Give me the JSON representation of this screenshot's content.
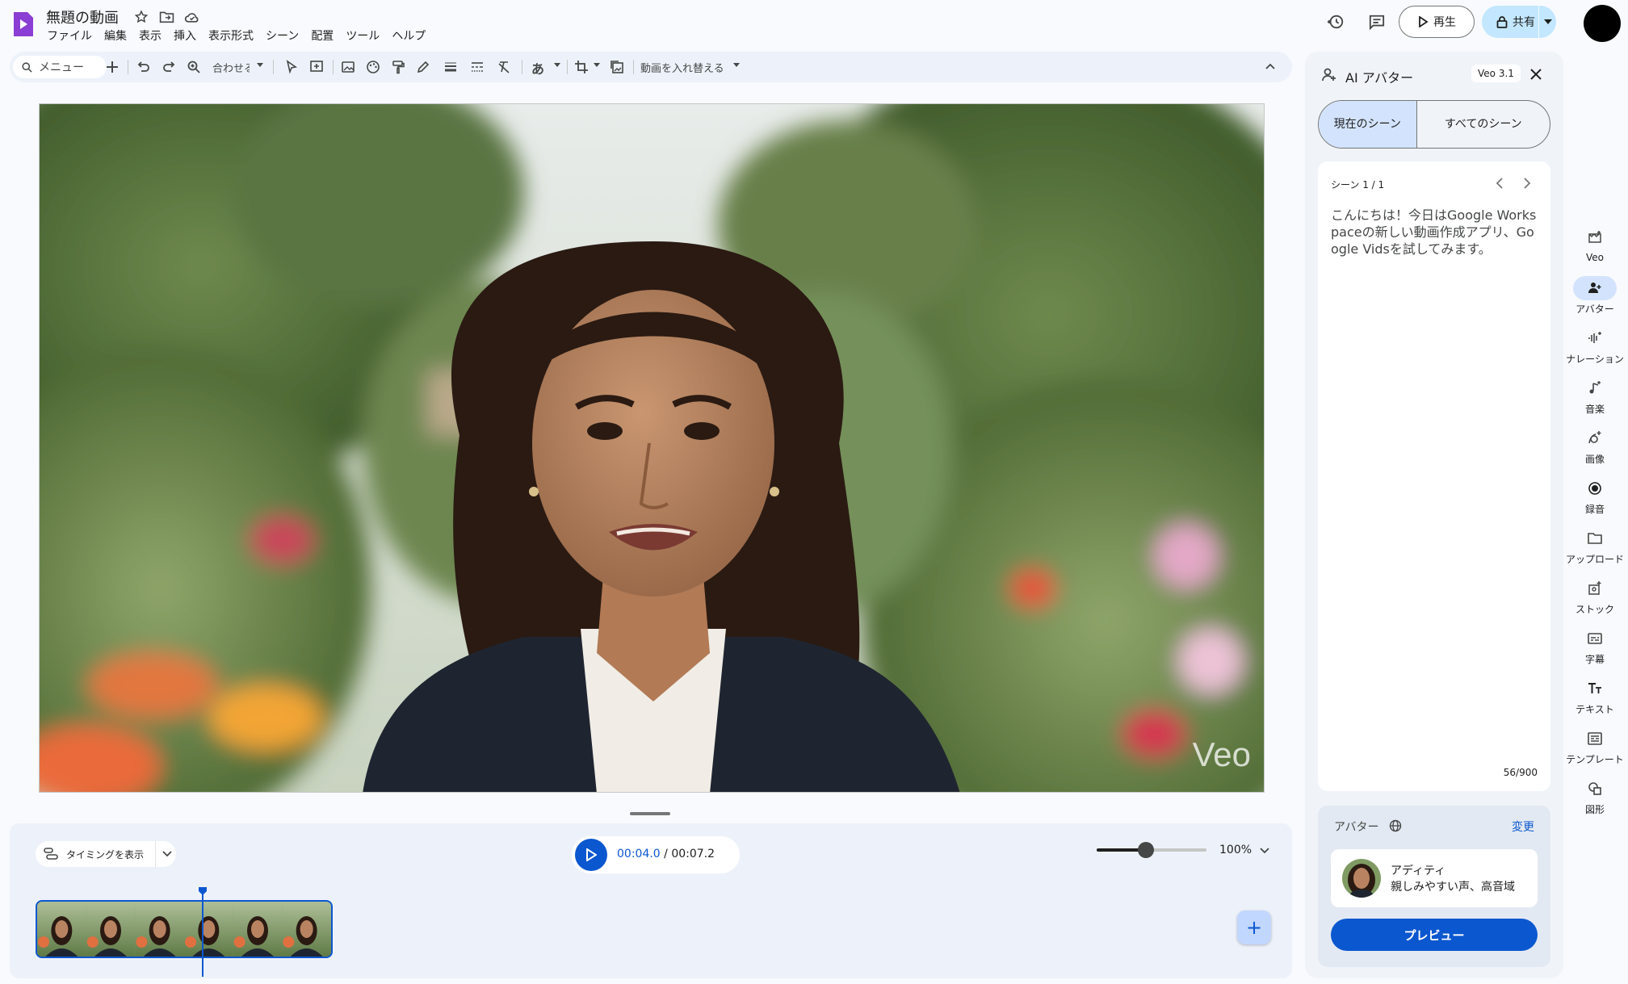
{
  "header": {
    "title": "無題の動画",
    "menu": [
      "ファイル",
      "編集",
      "表示",
      "挿入",
      "表示形式",
      "シーン",
      "配置",
      "ツール",
      "ヘルプ"
    ],
    "play_label": "再生",
    "share_label": "共有"
  },
  "toolbar": {
    "search_placeholder": "メニュー",
    "zoom_label": "合わせる",
    "replace_video_label": "動画を入れ替える"
  },
  "canvas": {
    "watermark": "Veo"
  },
  "timeline": {
    "timing_label": "タイミングを表示",
    "current_time": "00:04.0",
    "total_time": "/ 00:07.2",
    "zoom_percent": "100%",
    "zoom_slider_level": 0.45
  },
  "panel": {
    "title": "AI アバター",
    "model_badge": "Veo 3.1",
    "tabs": [
      "現在のシーン",
      "すべてのシーン"
    ],
    "active_tab": 0,
    "scene_label": "シーン 1 / 1",
    "script_text": "こんにちは！今日はGoogle Workspaceの新しい動画作成アプリ、Google Vidsを試してみます。",
    "char_count": "56/900",
    "avatar_section_label": "アバター",
    "change_label": "変更",
    "avatar_name": "アディティ",
    "avatar_desc": "親しみやすい声、高音域",
    "preview_label": "プレビュー"
  },
  "rail": [
    {
      "label": "Veo",
      "icon": "veo-icon"
    },
    {
      "label": "アバター",
      "icon": "avatar-add-icon",
      "active": true
    },
    {
      "label": "ナレーション",
      "icon": "narration-icon"
    },
    {
      "label": "音楽",
      "icon": "music-icon"
    },
    {
      "label": "画像",
      "icon": "image-add-icon"
    },
    {
      "label": "録音",
      "icon": "record-icon"
    },
    {
      "label": "アップロード",
      "icon": "folder-icon"
    },
    {
      "label": "ストック",
      "icon": "stock-icon"
    },
    {
      "label": "字幕",
      "icon": "captions-icon"
    },
    {
      "label": "テキスト",
      "icon": "text-icon"
    },
    {
      "label": "テンプレート",
      "icon": "template-icon"
    },
    {
      "label": "図形",
      "icon": "shapes-icon"
    }
  ],
  "colors": {
    "accent": "#0b57d0",
    "logo": "#8b3ed3",
    "panel_bg": "#f0f4f9",
    "share_bg": "#c2e7ff"
  }
}
